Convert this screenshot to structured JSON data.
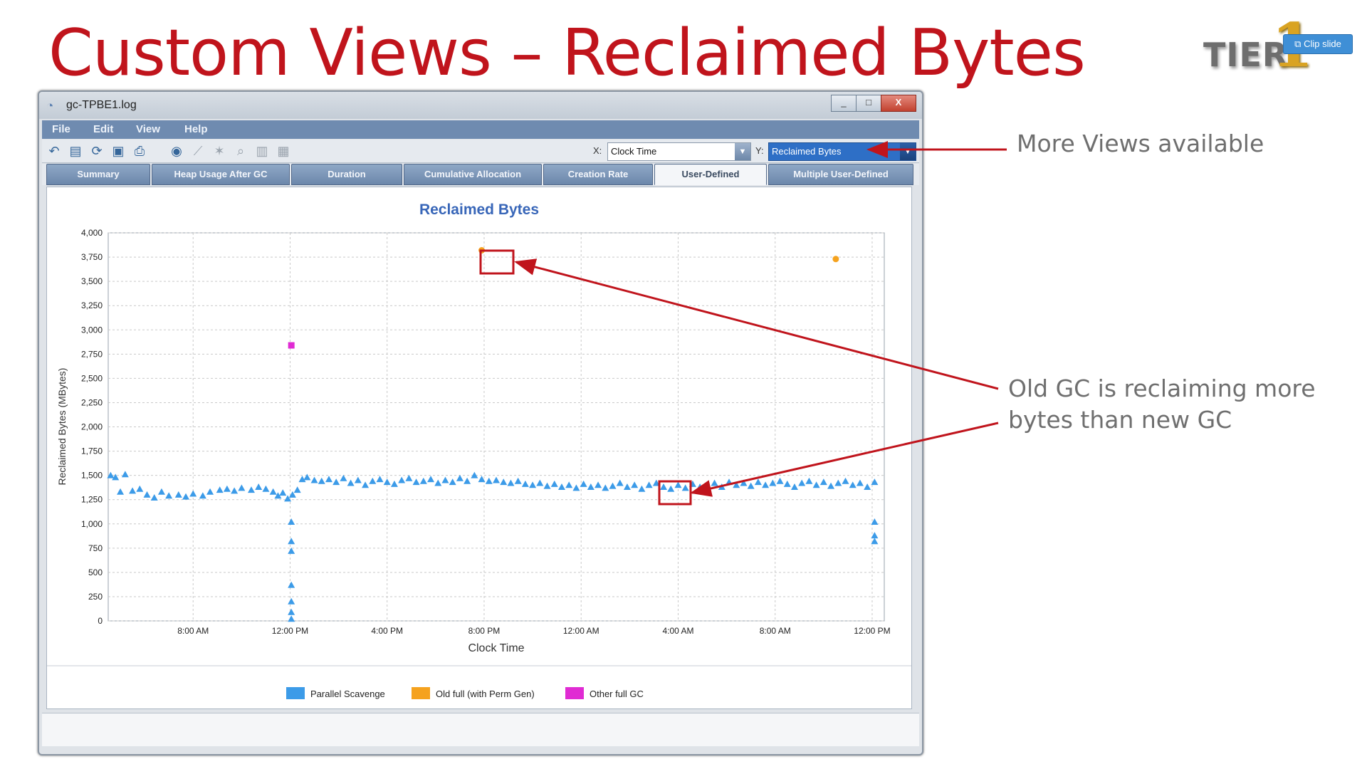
{
  "slide": {
    "title": "Custom Views – Reclaimed Bytes",
    "logo_text": "TIER",
    "logo_digit": "1",
    "clip_button": "Clip slide",
    "callouts": {
      "more_views": "More Views available",
      "old_gc_line1": "Old GC is reclaiming more",
      "old_gc_line2": "bytes than new GC"
    }
  },
  "window": {
    "title": "gc-TPBE1.log",
    "controls": [
      "_",
      "□",
      "X"
    ],
    "menu": [
      "File",
      "Edit",
      "View",
      "Help"
    ],
    "toolbar": {
      "x_label": "X:",
      "x_value": "Clock Time",
      "y_label": "Y:",
      "y_value": "Reclaimed Bytes",
      "icons": [
        "undo-icon",
        "open-icon",
        "refresh-icon",
        "save-icon",
        "print-icon",
        "globe-icon",
        "wand-icon",
        "magic-icon",
        "zoom-icon",
        "chart-icon",
        "chart-alt-icon"
      ]
    },
    "tabs": [
      "Summary",
      "Heap Usage After GC",
      "Duration",
      "Cumulative Allocation",
      "Creation Rate",
      "User-Defined",
      "Multiple User-Defined"
    ],
    "active_tab": "User-Defined"
  },
  "colors": {
    "parallel": "#3c9be8",
    "old_full": "#f5a21e",
    "other_full": "#e02bd3",
    "accent": "#c0141c",
    "chart_title": "#3866b8"
  },
  "chart_data": {
    "type": "scatter",
    "title": "Reclaimed Bytes",
    "xlabel": "Clock Time",
    "ylabel": "Reclaimed Bytes (MBytes)",
    "ylim": [
      0,
      4000
    ],
    "y_ticks": [
      "0",
      "250",
      "500",
      "750",
      "1,000",
      "1,250",
      "1,500",
      "1,750",
      "2,000",
      "2,250",
      "2,500",
      "2,750",
      "3,000",
      "3,250",
      "3,500",
      "3,750",
      "4,000"
    ],
    "xlim": [
      0,
      32
    ],
    "x_ticks": [
      {
        "x": 3.5,
        "label": "8:00 AM"
      },
      {
        "x": 7.5,
        "label": "12:00 PM"
      },
      {
        "x": 11.5,
        "label": "4:00 PM"
      },
      {
        "x": 15.5,
        "label": "8:00 PM"
      },
      {
        "x": 19.5,
        "label": "12:00 AM"
      },
      {
        "x": 23.5,
        "label": "4:00 AM"
      },
      {
        "x": 27.5,
        "label": "8:00 AM"
      },
      {
        "x": 31.5,
        "label": "12:00 PM"
      }
    ],
    "grid": true,
    "legend_position": "bottom",
    "series": [
      {
        "name": "Parallel Scavenge",
        "marker": "triangle",
        "points": [
          [
            0.1,
            1500
          ],
          [
            0.3,
            1480
          ],
          [
            0.5,
            1330
          ],
          [
            0.7,
            1510
          ],
          [
            1.0,
            1340
          ],
          [
            1.3,
            1360
          ],
          [
            1.6,
            1300
          ],
          [
            1.9,
            1270
          ],
          [
            2.2,
            1330
          ],
          [
            2.5,
            1290
          ],
          [
            2.9,
            1300
          ],
          [
            3.2,
            1280
          ],
          [
            3.5,
            1310
          ],
          [
            3.9,
            1290
          ],
          [
            4.2,
            1330
          ],
          [
            4.6,
            1350
          ],
          [
            4.9,
            1360
          ],
          [
            5.2,
            1340
          ],
          [
            5.5,
            1370
          ],
          [
            5.9,
            1350
          ],
          [
            6.2,
            1380
          ],
          [
            6.5,
            1360
          ],
          [
            6.8,
            1330
          ],
          [
            7.0,
            1290
          ],
          [
            7.2,
            1320
          ],
          [
            7.4,
            1260
          ],
          [
            7.6,
            1300
          ],
          [
            7.8,
            1350
          ],
          [
            8.0,
            1460
          ],
          [
            8.2,
            1480
          ],
          [
            8.5,
            1450
          ],
          [
            8.8,
            1440
          ],
          [
            9.1,
            1460
          ],
          [
            9.4,
            1430
          ],
          [
            9.7,
            1470
          ],
          [
            10.0,
            1420
          ],
          [
            10.3,
            1450
          ],
          [
            10.6,
            1400
          ],
          [
            10.9,
            1440
          ],
          [
            11.2,
            1460
          ],
          [
            11.5,
            1430
          ],
          [
            11.8,
            1410
          ],
          [
            12.1,
            1450
          ],
          [
            12.4,
            1470
          ],
          [
            12.7,
            1430
          ],
          [
            13.0,
            1440
          ],
          [
            13.3,
            1460
          ],
          [
            13.6,
            1420
          ],
          [
            13.9,
            1450
          ],
          [
            14.2,
            1430
          ],
          [
            14.5,
            1470
          ],
          [
            14.8,
            1440
          ],
          [
            15.1,
            1500
          ],
          [
            15.4,
            1460
          ],
          [
            15.7,
            1440
          ],
          [
            16.0,
            1450
          ],
          [
            16.3,
            1430
          ],
          [
            16.6,
            1420
          ],
          [
            16.9,
            1440
          ],
          [
            17.2,
            1410
          ],
          [
            17.5,
            1400
          ],
          [
            17.8,
            1420
          ],
          [
            18.1,
            1390
          ],
          [
            18.4,
            1410
          ],
          [
            18.7,
            1380
          ],
          [
            19.0,
            1400
          ],
          [
            19.3,
            1370
          ],
          [
            19.6,
            1410
          ],
          [
            19.9,
            1380
          ],
          [
            20.2,
            1400
          ],
          [
            20.5,
            1370
          ],
          [
            20.8,
            1390
          ],
          [
            21.1,
            1420
          ],
          [
            21.4,
            1380
          ],
          [
            21.7,
            1400
          ],
          [
            22.0,
            1360
          ],
          [
            22.3,
            1400
          ],
          [
            22.6,
            1420
          ],
          [
            22.9,
            1380
          ],
          [
            23.2,
            1360
          ],
          [
            23.5,
            1400
          ],
          [
            23.8,
            1370
          ],
          [
            24.1,
            1410
          ],
          [
            24.4,
            1380
          ],
          [
            24.7,
            1400
          ],
          [
            25.0,
            1420
          ],
          [
            25.3,
            1380
          ],
          [
            25.6,
            1430
          ],
          [
            25.9,
            1400
          ],
          [
            26.2,
            1420
          ],
          [
            26.5,
            1390
          ],
          [
            26.8,
            1430
          ],
          [
            27.1,
            1400
          ],
          [
            27.4,
            1420
          ],
          [
            27.7,
            1440
          ],
          [
            28.0,
            1410
          ],
          [
            28.3,
            1380
          ],
          [
            28.6,
            1420
          ],
          [
            28.9,
            1440
          ],
          [
            29.2,
            1400
          ],
          [
            29.5,
            1430
          ],
          [
            29.8,
            1390
          ],
          [
            30.1,
            1420
          ],
          [
            30.4,
            1440
          ],
          [
            30.7,
            1400
          ],
          [
            31.0,
            1420
          ],
          [
            31.3,
            1380
          ],
          [
            31.6,
            1430
          ],
          [
            7.55,
            1020
          ],
          [
            7.55,
            820
          ],
          [
            7.55,
            720
          ],
          [
            7.55,
            370
          ],
          [
            7.55,
            200
          ],
          [
            7.55,
            90
          ],
          [
            7.55,
            20
          ],
          [
            31.6,
            1020
          ],
          [
            31.6,
            880
          ],
          [
            31.6,
            820
          ]
        ]
      },
      {
        "name": "Old full (with Perm Gen)",
        "marker": "circle",
        "points": [
          [
            15.4,
            3820
          ],
          [
            30.0,
            3730
          ]
        ]
      },
      {
        "name": "Other full GC",
        "marker": "square",
        "points": [
          [
            7.55,
            2840
          ]
        ]
      }
    ]
  }
}
